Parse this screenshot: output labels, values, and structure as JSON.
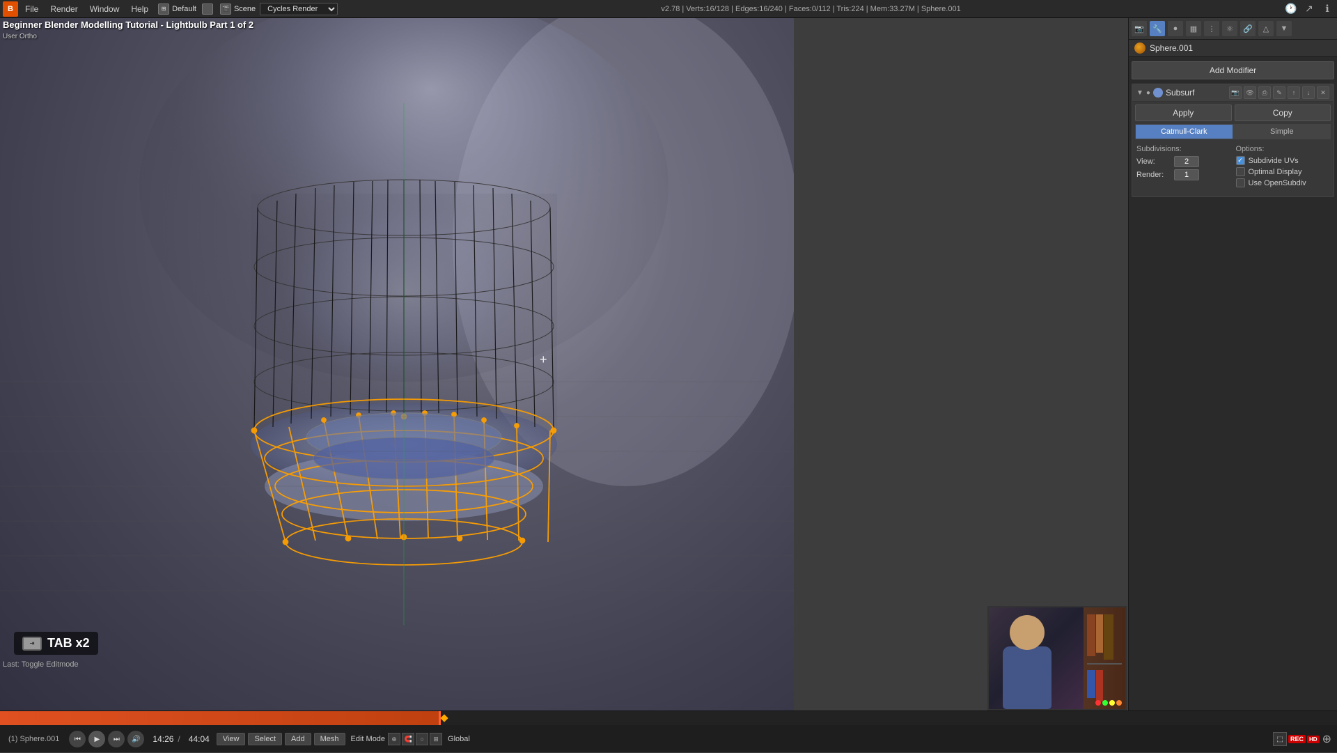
{
  "window": {
    "title": "Beginner Blender Modelling Tutorial - Lightbulb Part 1 of 2",
    "subtitle": "User Ortho"
  },
  "top_bar": {
    "blender_icon": "B",
    "menus": [
      "File",
      "Render",
      "Window",
      "Help"
    ],
    "workspace": "Default",
    "scene": "Scene",
    "engine": "Cycles Render",
    "version_info": "v2.78 | Verts:16/128 | Edges:16/240 | Faces:0/112 | Tris:224 | Mem:33.27M | Sphere.001"
  },
  "viewport": {
    "title": "Beginner Blender Modelling Tutorial - Lightbulb Part 1 of 2",
    "subtitle": "User Ortho",
    "crosshair_symbol": "+",
    "tab_indicator": "TAB x2",
    "last_action": "Last: Toggle Editmode"
  },
  "right_panel": {
    "object_name": "Sphere.001",
    "add_modifier_label": "Add Modifier",
    "modifier_name": "Subsurf",
    "apply_label": "Apply",
    "copy_label": "Copy",
    "algorithms": {
      "catmull_clark": "Catmull-Clark",
      "simple": "Simple"
    },
    "subdivisions_label": "Subdivisions:",
    "view_label": "View:",
    "view_value": "2",
    "render_label": "Render:",
    "render_value": "1",
    "options_label": "Options:",
    "options": [
      {
        "label": "Subdivide UVs",
        "checked": true
      },
      {
        "label": "Optimal Display",
        "checked": false
      },
      {
        "label": "Use OpenSubdiv",
        "checked": false
      }
    ]
  },
  "bottom_bar": {
    "timeline": {
      "current_frame": "14:26",
      "total_frames": "44:04",
      "progress_percent": 32.8
    },
    "object_info": "(1) Sphere.001",
    "viewport_modes": [
      "View",
      "Select",
      "Add",
      "Mesh"
    ],
    "view_mode": "Edit Mode",
    "shading_mode": "Global",
    "playback_controls": {
      "play_symbol": "▶",
      "prev_symbol": "⏮",
      "next_symbol": "⏭",
      "volume_symbol": "🔊"
    }
  }
}
